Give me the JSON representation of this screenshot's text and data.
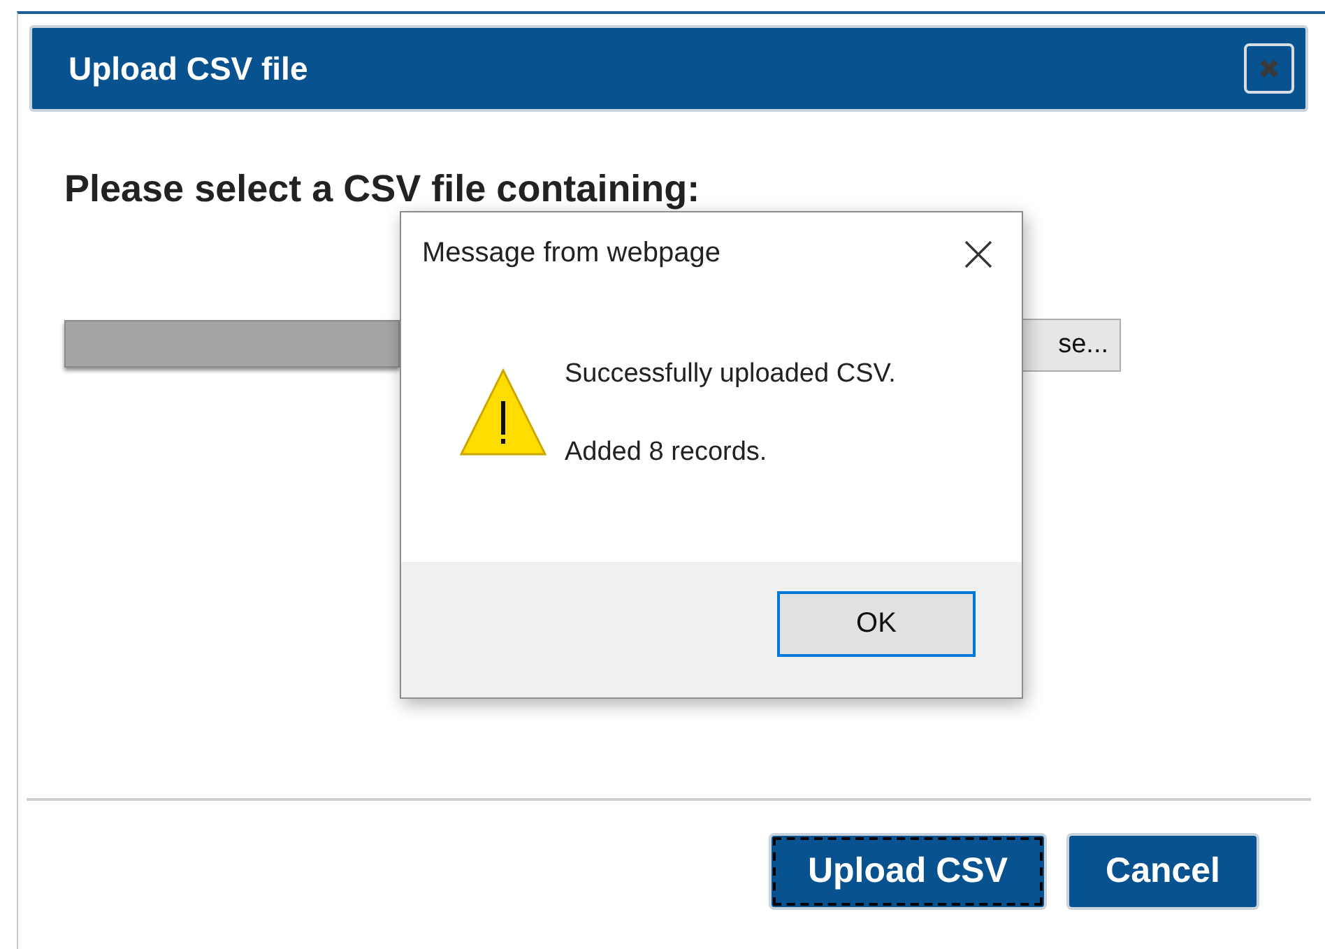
{
  "dialog": {
    "title": "Upload CSV file"
  },
  "heading": "Please select a CSV file containing:",
  "file_picker": {
    "browse_label": "se..."
  },
  "buttons": [
    {
      "label": "Upload CSV",
      "focused": true
    },
    {
      "label": "Cancel",
      "focused": false
    }
  ],
  "message_box": {
    "title": "Message from webpage",
    "lines": [
      "Successfully uploaded CSV.",
      "Added 8 records."
    ],
    "buttons": [
      {
        "label": "OK",
        "focused": true
      }
    ]
  }
}
